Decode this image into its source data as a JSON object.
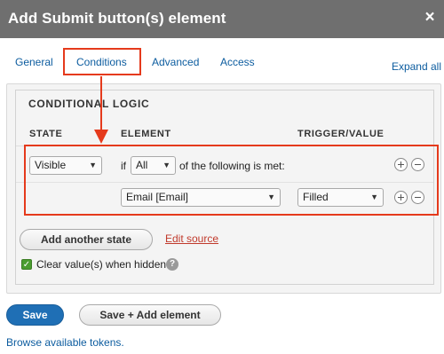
{
  "dialog": {
    "title": "Add Submit button(s) element",
    "close_glyph": "×"
  },
  "tabs": [
    {
      "label": "General"
    },
    {
      "label": "Conditions"
    },
    {
      "label": "Advanced"
    },
    {
      "label": "Access"
    }
  ],
  "expand_all": "Expand all",
  "conditional": {
    "legend": "CONDITIONAL LOGIC",
    "headers": {
      "state": "STATE",
      "element": "ELEMENT",
      "trigger": "TRIGGER/VALUE"
    },
    "row1": {
      "state": "Visible",
      "if_text": "if",
      "all": "All",
      "following": "of the following is met:"
    },
    "row2": {
      "element": "Email [Email]",
      "trigger": "Filled"
    }
  },
  "add_state": "Add another state",
  "edit_source": "Edit source",
  "clear_label": "Clear value(s) when hidden",
  "help_glyph": "?",
  "footer": {
    "save": "Save",
    "save_add": "Save + Add element",
    "tokens": "Browse available tokens."
  },
  "colors": {
    "highlight": "#e53a1c",
    "link": "#0c5c9f",
    "primary": "#1f6fb5",
    "titlebar": "#6f6f6f"
  }
}
